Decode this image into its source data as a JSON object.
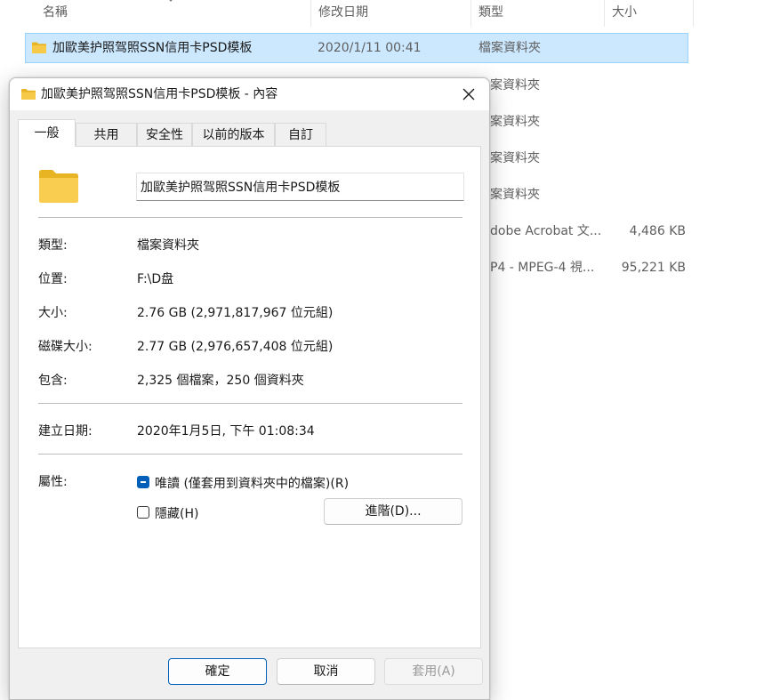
{
  "explorer": {
    "columns": [
      "名稱",
      "修改日期",
      "類型",
      "大小"
    ],
    "selected_row": {
      "name": "加歐美护照驾照SSN信用卡PSD模板",
      "date": "2020/1/11 00:41",
      "type": "檔案資料夾"
    },
    "rows": [
      {
        "type": "案資料夾",
        "size": ""
      },
      {
        "type": "案資料夾",
        "size": ""
      },
      {
        "type": "案資料夾",
        "size": ""
      },
      {
        "type": "案資料夾",
        "size": ""
      },
      {
        "type": "dobe Acrobat 文...",
        "size": "4,486 KB"
      },
      {
        "type": "P4 - MPEG-4 視...",
        "size": "95,221 KB"
      }
    ]
  },
  "dialog": {
    "title": "加歐美护照驾照SSN信用卡PSD模板 - 內容",
    "tabs": [
      "一般",
      "共用",
      "安全性",
      "以前的版本",
      "自訂"
    ],
    "name_value": "加歐美护照驾照SSN信用卡PSD模板",
    "props": {
      "type_label": "類型:",
      "type_value": "檔案資料夾",
      "location_label": "位置:",
      "location_value": "F:\\D盘",
      "size_label": "大小:",
      "size_value": "2.76 GB (2,971,817,967 位元組)",
      "disk_size_label": "磁碟大小:",
      "disk_size_value": "2.77 GB (2,976,657,408 位元組)",
      "contains_label": "包含:",
      "contains_value": "2,325 個檔案，250 個資料夾",
      "created_label": "建立日期:",
      "created_value": "2020年1月5日, 下午 01:08:34",
      "attributes_label": "屬性:"
    },
    "attributes": {
      "readonly_label": "唯讀 (僅套用到資料夾中的檔案)(R)",
      "hidden_label": "隱藏(H)",
      "advanced_button": "進階(D)..."
    },
    "buttons": {
      "ok": "確定",
      "cancel": "取消",
      "apply": "套用(A)"
    },
    "colors": {
      "accent": "#005fb8",
      "selection": "#cce8ff",
      "folder": "#f7c948"
    }
  }
}
